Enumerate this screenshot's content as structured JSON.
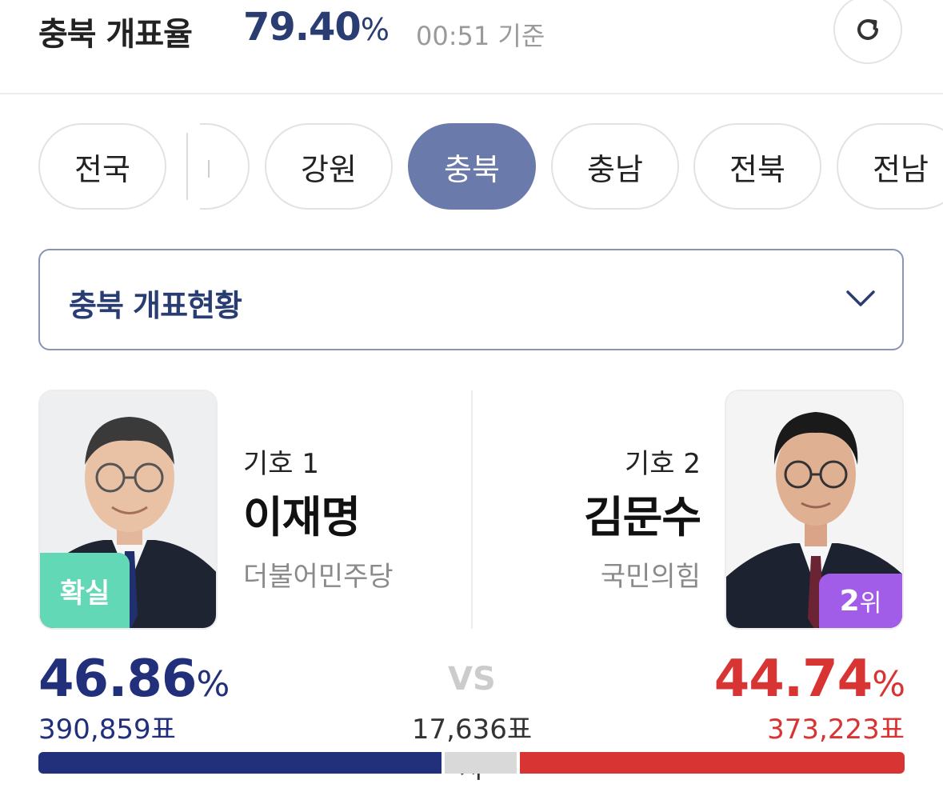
{
  "header": {
    "title": "충북 개표율",
    "rate_value": "79.40",
    "rate_unit": "%",
    "time": "00:51 기준"
  },
  "region_tabs": [
    {
      "label": "전국",
      "active": false
    },
    {
      "label": "강원",
      "active": false
    },
    {
      "label": "충북",
      "active": true
    },
    {
      "label": "충남",
      "active": false
    },
    {
      "label": "전북",
      "active": false
    },
    {
      "label": "전남",
      "active": false
    }
  ],
  "dropdown": {
    "label": "충북 개표현황"
  },
  "candidates": {
    "left": {
      "number_label": "기호 1",
      "name": "이재명",
      "party": "더불어민주당",
      "badge": "확실",
      "percent": "46.86",
      "percent_unit": "%",
      "votes": "390,859표",
      "color": "#22307c"
    },
    "right": {
      "number_label": "기호 2",
      "name": "김문수",
      "party": "국민의힘",
      "rank_number": "2",
      "rank_unit": "위",
      "percent": "44.74",
      "percent_unit": "%",
      "votes": "373,223표",
      "color": "#d93434"
    }
  },
  "comparison": {
    "vs_label": "VS",
    "difference": "17,636표차"
  },
  "vote_bar": {
    "left_share": 46.86,
    "right_share": 44.74,
    "left_color": "#22307c",
    "middle_color": "#d9d9d9",
    "right_color": "#d93434"
  },
  "icons": {
    "refresh": "refresh-icon",
    "dropdown": "chevron-down-icon"
  }
}
